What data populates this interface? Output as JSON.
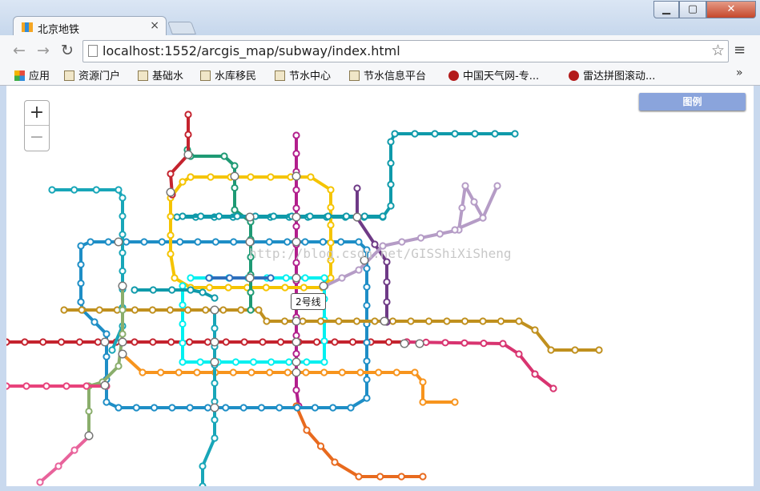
{
  "window": {
    "tab_title": "北京地铁",
    "tab_close": "×",
    "min_glyph": "▁",
    "max_glyph": "▢",
    "close_glyph": "✕"
  },
  "toolbar": {
    "back": "←",
    "forward": "→",
    "reload": "↻",
    "url": "localhost:1552/arcgis_map/subway/index.html",
    "star": "☆",
    "menu": "≡"
  },
  "bookmarks": [
    {
      "label": "应用",
      "icon": "apps-icon"
    },
    {
      "label": "资源门户",
      "icon": "image-icon"
    },
    {
      "label": "基础水",
      "icon": "image-icon"
    },
    {
      "label": "水库移民",
      "icon": "image-icon"
    },
    {
      "label": "节水中心",
      "icon": "image-icon"
    },
    {
      "label": "节水信息平台",
      "icon": "image-icon"
    },
    {
      "label": "中国天气网-专...",
      "icon": "weather-icon"
    },
    {
      "label": "雷达拼图滚动...",
      "icon": "weather-icon"
    }
  ],
  "bookmarks_more": "»",
  "map": {
    "zoom_in": "+",
    "zoom_out": "−",
    "legend_button": "图例",
    "tooltip": "2号线",
    "watermark": "http://blog.csdn.net/GISShiXiSheng",
    "lines": [
      {
        "color": "#c4232e"
      },
      {
        "color": "#1e8ec6"
      },
      {
        "color": "#f5c400"
      },
      {
        "color": "#0f9aaa"
      },
      {
        "color": "#b21f8c"
      },
      {
        "color": "#c0901e"
      },
      {
        "color": "#f7941d"
      },
      {
        "color": "#00f0f0"
      },
      {
        "color": "#1e9a74"
      },
      {
        "color": "#2c6fbd"
      },
      {
        "color": "#6e3a86"
      },
      {
        "color": "#8aae6c"
      },
      {
        "color": "#e8437c"
      },
      {
        "color": "#e8639b"
      },
      {
        "color": "#b59cc6"
      },
      {
        "color": "#e86a1e"
      },
      {
        "color": "#18a6b8"
      },
      {
        "color": "#d83470"
      }
    ]
  }
}
